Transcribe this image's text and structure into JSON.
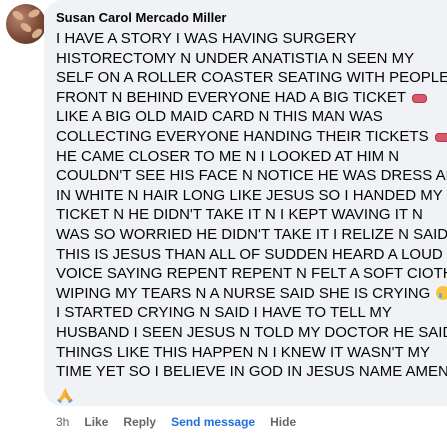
{
  "comment": {
    "author": "Susan Carol Mercado Miller",
    "lines": [
      "I HAVE A STORY I WAS HAVING SURGERY",
      "HISTORECTOMY N UNDER ANATISTIA N SEEN MY",
      "SELF ON A ROLLER COASTER SEATING WITH PEOPLE IN",
      "FRONT N BEHIND EVERYONE HAD A BIG TICKET",
      "LIKE A BIG OLD MAID CARD N THIS MAN WAS",
      "COLLECTING EVERYONE HANDING THEIR TICKETS",
      "HE CAME CLOSER TO ME N I LOOKED AT HIM N",
      "COULDN'T SEE HIS FACE N NOTICE HE WAS DRESS ALL",
      "IN WHITE N HAIR LONG LIKE JESUS SO I HANDED MY",
      "TICKET N HE DIDN'T TAKE IT N I KEPT WAVING IT N",
      "WAS SO WORRIED HE DIDN'T TAKE IT I RELIZE N SAID",
      "THIS IS JESUS THAN ALL OF SUDDEN HEARD A LOUD",
      "VOICE SAYING REPENT REPENT N FELT A SOFT CIOTH",
      "WIPING MY TEARS N A NURSE SAID SHE IS CRYING",
      "I STARTED CRYING N SAID I HAVE TO TELL MY",
      "HUSBAND I SEEN JESUS N TOLD MY DOCTOR HE SAID",
      "THINGS LIKE THIS HAPPEN N I KNEW IT WASN'T MY",
      "TIME YET SO I BELIEVE IN GOD IN JESUS NAME AMEN"
    ],
    "emoji": {
      "ticket": "ticket-emoji",
      "crying": "crying-face-emoji",
      "pray": "folded-hands-emoji"
    }
  },
  "actions": {
    "timestamp": "3h",
    "like": "Like",
    "reply": "Reply",
    "send_message": "Send message",
    "hide": "Hide"
  },
  "colors": {
    "bubble": "#f0f2f5",
    "text": "#050505",
    "muted": "#65676b",
    "link": "#216fdb"
  }
}
